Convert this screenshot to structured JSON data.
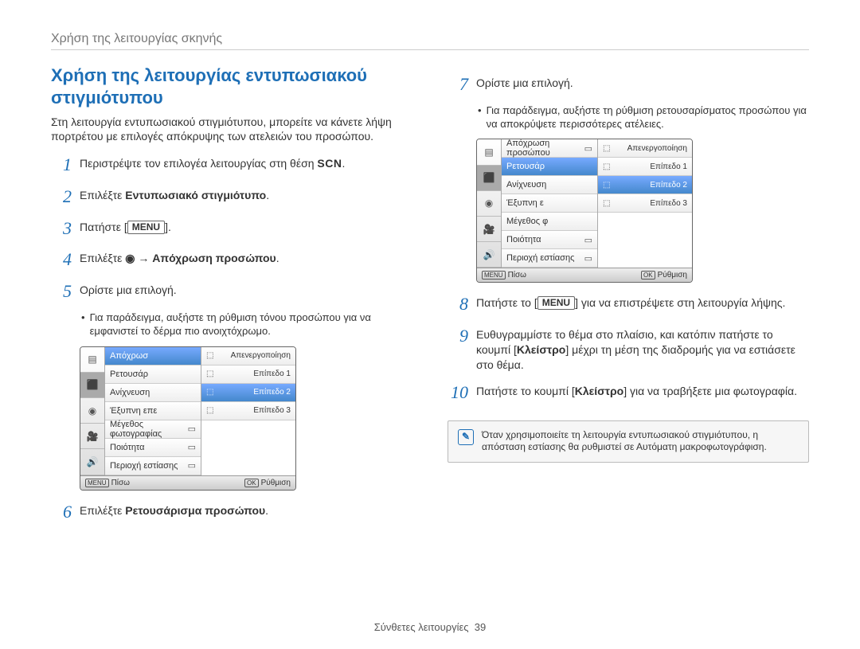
{
  "header": "Χρήση της λειτουργίας σκηνής",
  "left": {
    "title": "Χρήση της λειτουργίας εντυπωσιακού στιγμιότυπου",
    "intro": "Στη λειτουργία εντυπωσιακού στιγμιότυπου, μπορείτε να κάνετε λήψη πορτρέτου με επιλογές απόκρυψης των ατελειών του προσώπου.",
    "step1_a": "Περιστρέψτε τον επιλογέα λειτουργίας στη θέση ",
    "step1_scn": "SCN",
    "step1_b": ".",
    "step2_a": "Επιλέξτε ",
    "step2_b": "Εντυπωσιακό στιγμιότυπο",
    "step2_c": ".",
    "step3_a": "Πατήστε [",
    "step3_menu": "MENU",
    "step3_b": "].",
    "step4_a": "Επιλέξτε ",
    "step4_icon": "◉",
    "step4_arrow": " → ",
    "step4_b": "Απόχρωση προσώπου",
    "step4_c": ".",
    "step5": "Ορίστε μια επιλογή.",
    "step5_bullet": "Για παράδειγμα, αυξήστε τη ρύθμιση τόνου προσώπου για να εμφανιστεί το δέρμα πιο ανοιχτόχρωμο.",
    "step6_a": "Επιλέξτε ",
    "step6_b": "Ρετουσάρισμα προσώπου",
    "step6_c": "."
  },
  "mock1": {
    "leftIcons": [
      "▦",
      "📷",
      "🎥",
      "🕪"
    ],
    "rows": [
      {
        "label": "Απόχρωσ",
        "right": ""
      },
      {
        "label": "Ρετουσάρ",
        "right": ""
      },
      {
        "label": "Ανίχνευση",
        "right": ""
      },
      {
        "label": "Έξυπνη επε",
        "right": ""
      },
      {
        "label": "Μέγεθος φωτογραφίας",
        "right": ""
      },
      {
        "label": "Ποιότητα",
        "right": ""
      },
      {
        "label": "Περιοχή εστίασης",
        "right": ""
      }
    ],
    "sub": [
      {
        "label": "Απενεργοποίηση"
      },
      {
        "label": "Επίπεδο 1"
      },
      {
        "label": "Επίπεδο 2"
      },
      {
        "label": "Επίπεδο 3"
      }
    ],
    "back": "Πίσω",
    "backKey": "MENU",
    "okKey": "OK",
    "ok": "Ρύθμιση"
  },
  "right": {
    "step7": "Ορίστε μια επιλογή.",
    "step7_bullet": "Για παράδειγμα, αυξήστε τη ρύθμιση ρετουσαρίσματος προσώπου για να αποκρύψετε περισσότερες ατέλειες.",
    "step8_a": "Πατήστε το [",
    "step8_menu": "MENU",
    "step8_b": "] για να επιστρέψετε στη λειτουργία λήψης.",
    "step9_a": "Ευθυγραμμίστε το θέμα στο πλαίσιο, και κατόπιν πατήστε το κουμπί [",
    "step9_b": "Κλείστρο",
    "step9_c": "] μέχρι τη μέση της διαδρομής για να εστιάσετε στο θέμα.",
    "step10_a": "Πατήστε το κουμπί [",
    "step10_b": "Κλείστρο",
    "step10_c": "] για να τραβήξετε μια φωτογραφία.",
    "note": "Όταν χρησιμοποιείτε τη λειτουργία εντυπωσιακού στιγμιότυπου, η απόσταση εστίασης θα ρυθμιστεί σε Αυτόματη μακροφωτογράφιση."
  },
  "mock2": {
    "leftIcons": [
      "▦",
      "📷",
      "🎥",
      "🕪"
    ],
    "label_faceTone": "Απόχρωση προσώπου",
    "label_retouch": "Ρετουσάρ",
    "label_detect": "Ανίχνευση",
    "label_smart": "Έξυπνη ε",
    "label_size": "Μέγεθος φ",
    "label_quality": "Ποιότητα",
    "label_focus": "Περιοχή εστίασης",
    "sub_off": "Απενεργοποίηση",
    "sub_l1": "Επίπεδο 1",
    "sub_l2": "Επίπεδο 2",
    "sub_l3": "Επίπεδο 3",
    "back": "Πίσω",
    "backKey": "MENU",
    "okKey": "OK",
    "ok": "Ρύθμιση"
  },
  "footer_label": "Σύνθετες λειτουργίες",
  "footer_page": "39"
}
